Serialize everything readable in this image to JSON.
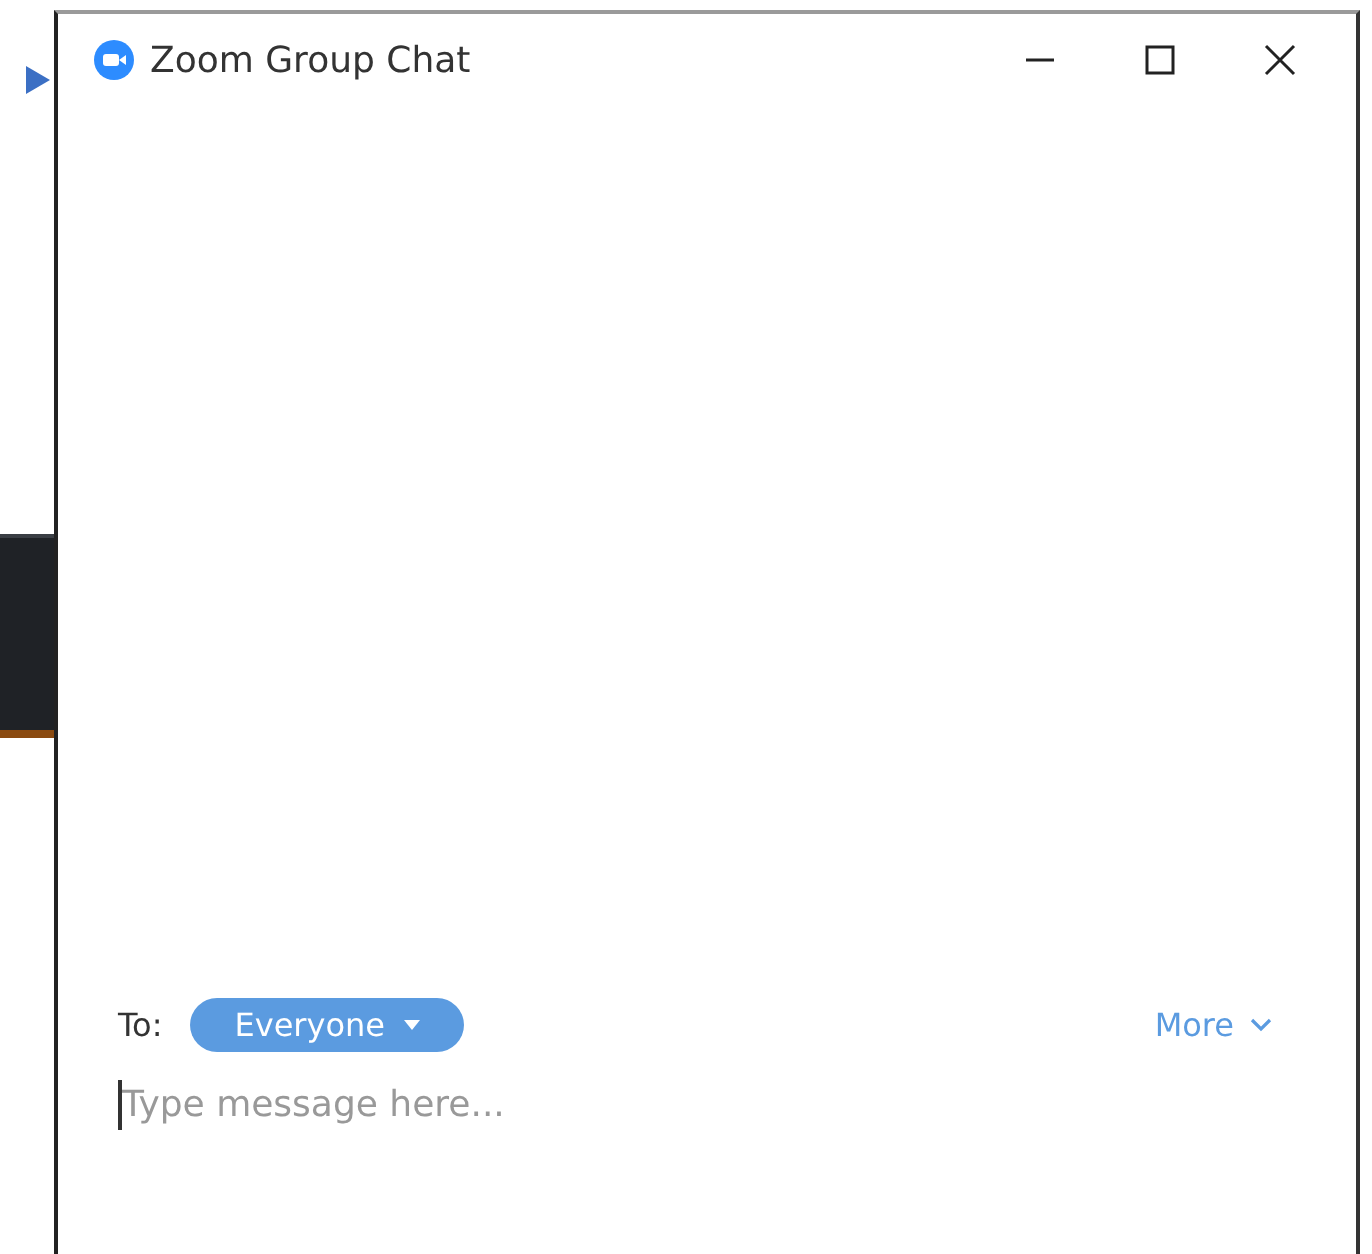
{
  "window": {
    "title": "Zoom Group Chat"
  },
  "chat": {
    "to_label": "To:",
    "recipient": "Everyone",
    "more": "More",
    "message": {
      "placeholder": "Type message here..."
    }
  }
}
